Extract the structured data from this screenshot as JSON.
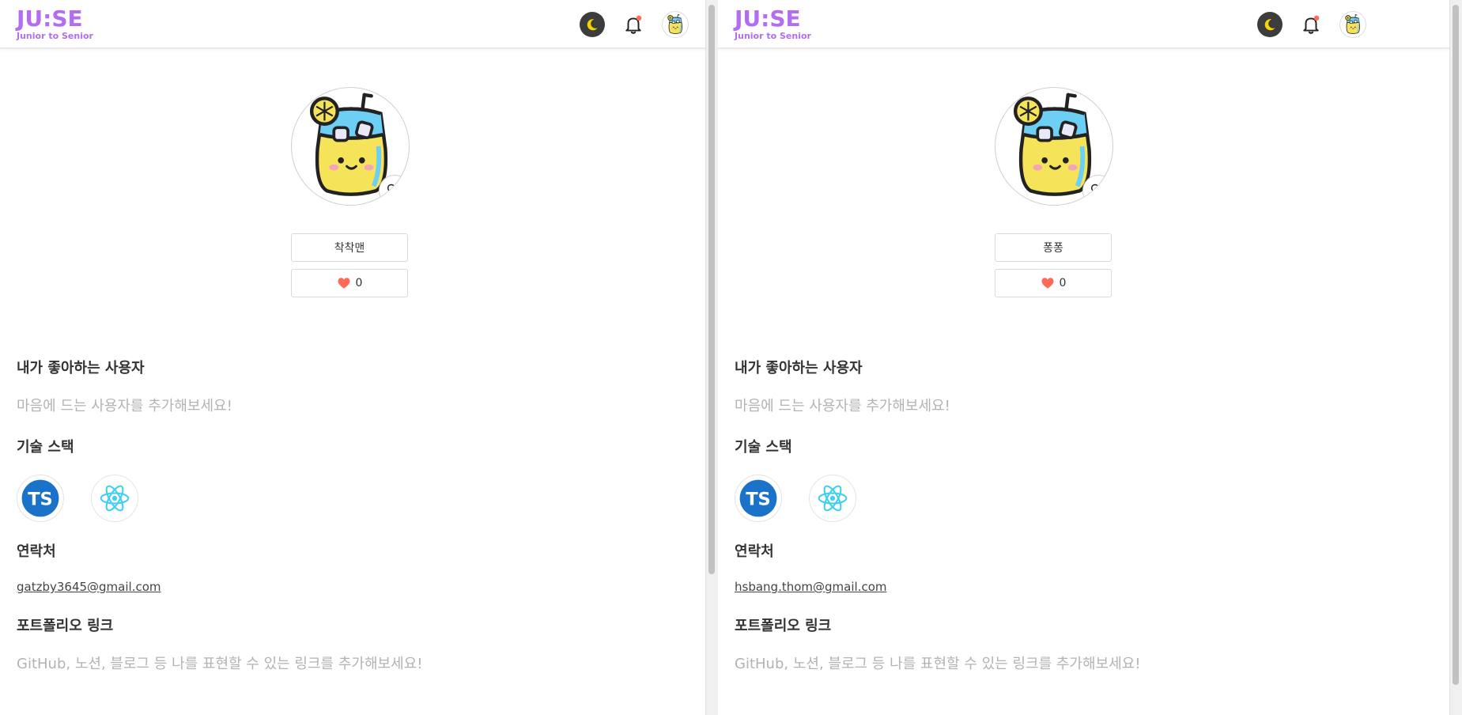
{
  "colors": {
    "brand": "#b36df2",
    "heart": "#ff6b57",
    "notification_dot": "#ff6b57",
    "placeholder_text": "#b3b3b3"
  },
  "logo": {
    "title": "JU:SE",
    "subtitle": "Junior to Senior"
  },
  "sections": {
    "liked_users": {
      "title": "내가 좋아하는 사용자",
      "placeholder": "마음에 드는 사용자를 추가해보세요!"
    },
    "tech_stack": {
      "title": "기술 스택",
      "items": [
        "typescript-icon",
        "react-icon"
      ]
    },
    "contact": {
      "title": "연락처"
    },
    "portfolio": {
      "title": "포트폴리오 링크",
      "placeholder": "GitHub, 노션, 블로그 등 나를 표현할 수 있는 링크를 추가해보세요!"
    }
  },
  "panes": {
    "left": {
      "nickname": "착착맨",
      "likes": "0",
      "email": "gatzby3645@gmail.com"
    },
    "right": {
      "nickname": "퐁퐁",
      "likes": "0",
      "email": "hsbang.thom@gmail.com"
    }
  },
  "icons": {
    "theme_toggle": "moon-icon",
    "notifications": "bell-icon",
    "profile_avatar": "lemonade-avatar-icon",
    "like_button": "heart-outline-icon",
    "likes_count": "heart-filled-icon"
  }
}
